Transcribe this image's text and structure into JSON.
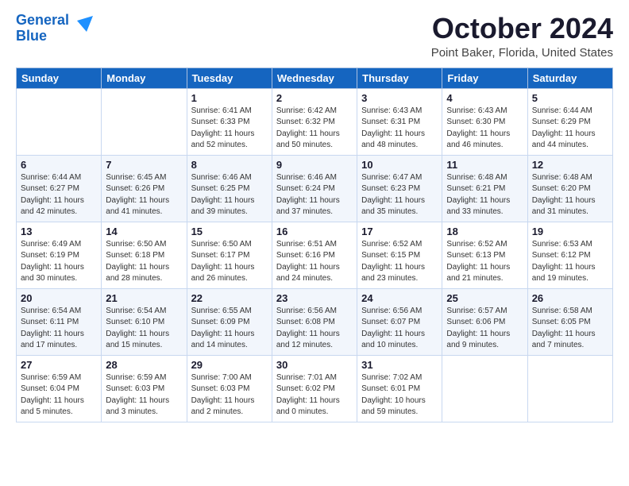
{
  "logo": {
    "line1": "General",
    "line2": "Blue",
    "arrow_color": "#1e90ff"
  },
  "title": "October 2024",
  "location": "Point Baker, Florida, United States",
  "weekdays": [
    "Sunday",
    "Monday",
    "Tuesday",
    "Wednesday",
    "Thursday",
    "Friday",
    "Saturday"
  ],
  "weeks": [
    [
      {
        "day": "",
        "info": ""
      },
      {
        "day": "",
        "info": ""
      },
      {
        "day": "1",
        "info": "Sunrise: 6:41 AM\nSunset: 6:33 PM\nDaylight: 11 hours and 52 minutes."
      },
      {
        "day": "2",
        "info": "Sunrise: 6:42 AM\nSunset: 6:32 PM\nDaylight: 11 hours and 50 minutes."
      },
      {
        "day": "3",
        "info": "Sunrise: 6:43 AM\nSunset: 6:31 PM\nDaylight: 11 hours and 48 minutes."
      },
      {
        "day": "4",
        "info": "Sunrise: 6:43 AM\nSunset: 6:30 PM\nDaylight: 11 hours and 46 minutes."
      },
      {
        "day": "5",
        "info": "Sunrise: 6:44 AM\nSunset: 6:29 PM\nDaylight: 11 hours and 44 minutes."
      }
    ],
    [
      {
        "day": "6",
        "info": "Sunrise: 6:44 AM\nSunset: 6:27 PM\nDaylight: 11 hours and 42 minutes."
      },
      {
        "day": "7",
        "info": "Sunrise: 6:45 AM\nSunset: 6:26 PM\nDaylight: 11 hours and 41 minutes."
      },
      {
        "day": "8",
        "info": "Sunrise: 6:46 AM\nSunset: 6:25 PM\nDaylight: 11 hours and 39 minutes."
      },
      {
        "day": "9",
        "info": "Sunrise: 6:46 AM\nSunset: 6:24 PM\nDaylight: 11 hours and 37 minutes."
      },
      {
        "day": "10",
        "info": "Sunrise: 6:47 AM\nSunset: 6:23 PM\nDaylight: 11 hours and 35 minutes."
      },
      {
        "day": "11",
        "info": "Sunrise: 6:48 AM\nSunset: 6:21 PM\nDaylight: 11 hours and 33 minutes."
      },
      {
        "day": "12",
        "info": "Sunrise: 6:48 AM\nSunset: 6:20 PM\nDaylight: 11 hours and 31 minutes."
      }
    ],
    [
      {
        "day": "13",
        "info": "Sunrise: 6:49 AM\nSunset: 6:19 PM\nDaylight: 11 hours and 30 minutes."
      },
      {
        "day": "14",
        "info": "Sunrise: 6:50 AM\nSunset: 6:18 PM\nDaylight: 11 hours and 28 minutes."
      },
      {
        "day": "15",
        "info": "Sunrise: 6:50 AM\nSunset: 6:17 PM\nDaylight: 11 hours and 26 minutes."
      },
      {
        "day": "16",
        "info": "Sunrise: 6:51 AM\nSunset: 6:16 PM\nDaylight: 11 hours and 24 minutes."
      },
      {
        "day": "17",
        "info": "Sunrise: 6:52 AM\nSunset: 6:15 PM\nDaylight: 11 hours and 23 minutes."
      },
      {
        "day": "18",
        "info": "Sunrise: 6:52 AM\nSunset: 6:13 PM\nDaylight: 11 hours and 21 minutes."
      },
      {
        "day": "19",
        "info": "Sunrise: 6:53 AM\nSunset: 6:12 PM\nDaylight: 11 hours and 19 minutes."
      }
    ],
    [
      {
        "day": "20",
        "info": "Sunrise: 6:54 AM\nSunset: 6:11 PM\nDaylight: 11 hours and 17 minutes."
      },
      {
        "day": "21",
        "info": "Sunrise: 6:54 AM\nSunset: 6:10 PM\nDaylight: 11 hours and 15 minutes."
      },
      {
        "day": "22",
        "info": "Sunrise: 6:55 AM\nSunset: 6:09 PM\nDaylight: 11 hours and 14 minutes."
      },
      {
        "day": "23",
        "info": "Sunrise: 6:56 AM\nSunset: 6:08 PM\nDaylight: 11 hours and 12 minutes."
      },
      {
        "day": "24",
        "info": "Sunrise: 6:56 AM\nSunset: 6:07 PM\nDaylight: 11 hours and 10 minutes."
      },
      {
        "day": "25",
        "info": "Sunrise: 6:57 AM\nSunset: 6:06 PM\nDaylight: 11 hours and 9 minutes."
      },
      {
        "day": "26",
        "info": "Sunrise: 6:58 AM\nSunset: 6:05 PM\nDaylight: 11 hours and 7 minutes."
      }
    ],
    [
      {
        "day": "27",
        "info": "Sunrise: 6:59 AM\nSunset: 6:04 PM\nDaylight: 11 hours and 5 minutes."
      },
      {
        "day": "28",
        "info": "Sunrise: 6:59 AM\nSunset: 6:03 PM\nDaylight: 11 hours and 3 minutes."
      },
      {
        "day": "29",
        "info": "Sunrise: 7:00 AM\nSunset: 6:03 PM\nDaylight: 11 hours and 2 minutes."
      },
      {
        "day": "30",
        "info": "Sunrise: 7:01 AM\nSunset: 6:02 PM\nDaylight: 11 hours and 0 minutes."
      },
      {
        "day": "31",
        "info": "Sunrise: 7:02 AM\nSunset: 6:01 PM\nDaylight: 10 hours and 59 minutes."
      },
      {
        "day": "",
        "info": ""
      },
      {
        "day": "",
        "info": ""
      }
    ]
  ]
}
